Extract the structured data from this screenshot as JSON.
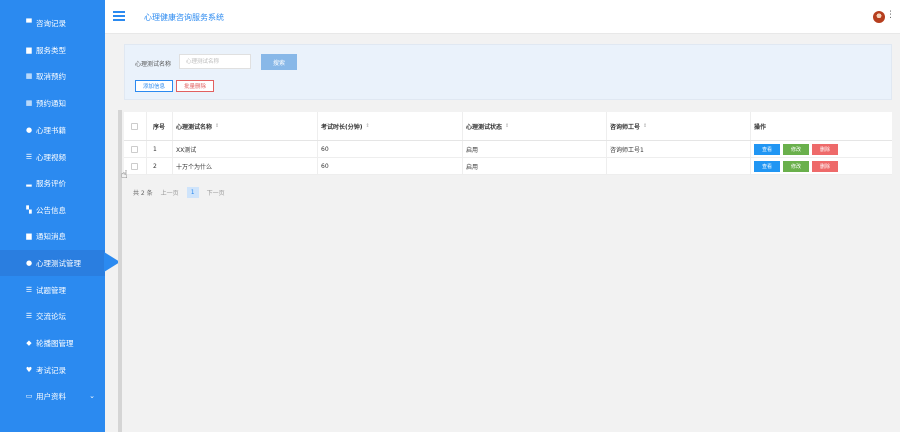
{
  "sidebar": {
    "items": [
      {
        "label": "咨询记录",
        "icon": "chat-icon",
        "glyph": "▀"
      },
      {
        "label": "服务类型",
        "icon": "briefcase-icon",
        "glyph": "▆"
      },
      {
        "label": "取消预约",
        "icon": "grid-icon",
        "glyph": "▦"
      },
      {
        "label": "预约通知",
        "icon": "grid-icon",
        "glyph": "▦"
      },
      {
        "label": "心理书籍",
        "icon": "user-icon",
        "glyph": "●"
      },
      {
        "label": "心理视频",
        "icon": "list-icon",
        "glyph": "☰"
      },
      {
        "label": "服务评价",
        "icon": "bar-chart-icon",
        "glyph": "▂"
      },
      {
        "label": "公告信息",
        "icon": "flag-icon",
        "glyph": "▚"
      },
      {
        "label": "通知消息",
        "icon": "lock-icon",
        "glyph": "▆"
      },
      {
        "label": "心理测试管理",
        "icon": "bulb-icon",
        "glyph": "●"
      },
      {
        "label": "试题管理",
        "icon": "list-icon",
        "glyph": "☰"
      },
      {
        "label": "交流论坛",
        "icon": "list-icon",
        "glyph": "☰"
      },
      {
        "label": "轮播图管理",
        "icon": "thumb-icon",
        "glyph": "◆"
      },
      {
        "label": "考试记录",
        "icon": "trophy-icon",
        "glyph": "♥"
      },
      {
        "label": "用户资料",
        "icon": "folder-icon",
        "glyph": "▭"
      }
    ],
    "active_index": 9,
    "expand_glyph": "⌄"
  },
  "header": {
    "title": "心理健康咨询服务系统",
    "more_glyph": "⋮"
  },
  "search": {
    "label": "心理测试名称",
    "placeholder": "心理测试名称",
    "value": "",
    "search_button": "搜索",
    "add_button": "添加信息",
    "batch_delete_button": "批量删除"
  },
  "table": {
    "columns": [
      "序号",
      "心理测试名称",
      "考试时长(分钟)",
      "心理测试状态",
      "咨询师工号",
      "操作"
    ],
    "sort_glyph": "⇕",
    "rows": [
      {
        "index": "1",
        "name": "XX测试",
        "duration": "60",
        "status": "启用",
        "counselor_id": "咨询师工号1"
      },
      {
        "index": "2",
        "name": "十万个为什么",
        "duration": "60",
        "status": "启用",
        "counselor_id": ""
      }
    ],
    "actions": {
      "view": "查看",
      "edit": "修改",
      "delete": "删除"
    }
  },
  "pager": {
    "total": "共 2 条",
    "prev": "上一页",
    "current": "1",
    "next": "下一页"
  },
  "colors": {
    "sidebar_bg": "#2b8af0",
    "accent": "#2b8af0",
    "view_button": "#2196f3",
    "edit_button": "#6ab04c",
    "delete_button": "#ee6a6a"
  }
}
